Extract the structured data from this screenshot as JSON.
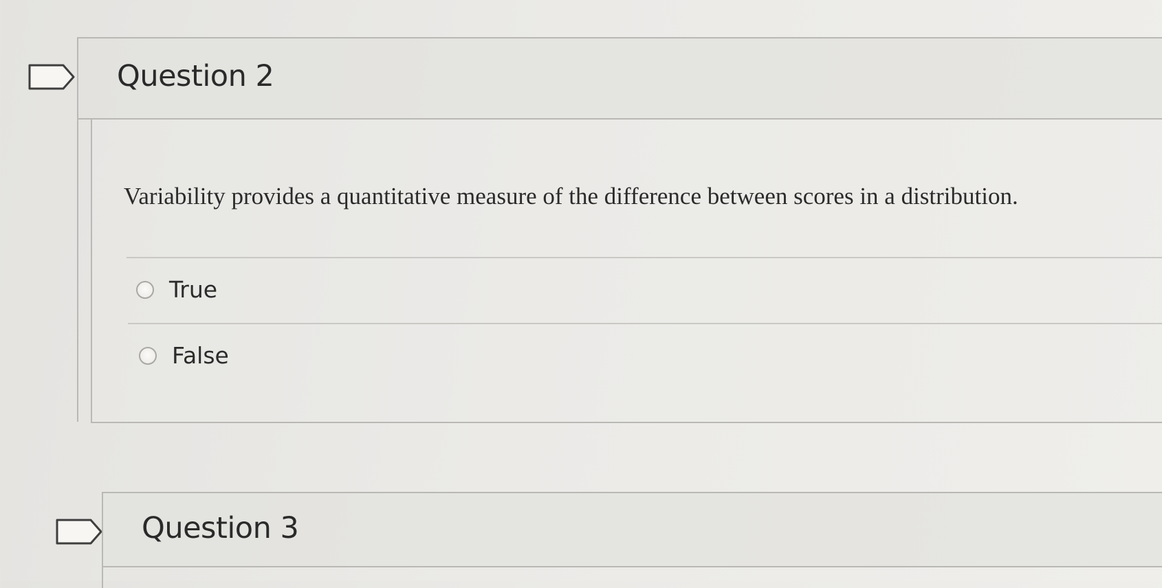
{
  "questions": [
    {
      "title": "Question 2",
      "text": "Variability provides a quantitative measure of the difference between scores in a distribution.",
      "answers": [
        {
          "label": "True",
          "selected": false
        },
        {
          "label": "False",
          "selected": false
        }
      ]
    },
    {
      "title": "Question 3"
    }
  ],
  "icons": {
    "flag": "bookmark-flag-icon",
    "radio": "radio-button"
  },
  "colors": {
    "background": "#ebeae7",
    "border": "#b9b8b4",
    "text": "#2b2b2b"
  }
}
